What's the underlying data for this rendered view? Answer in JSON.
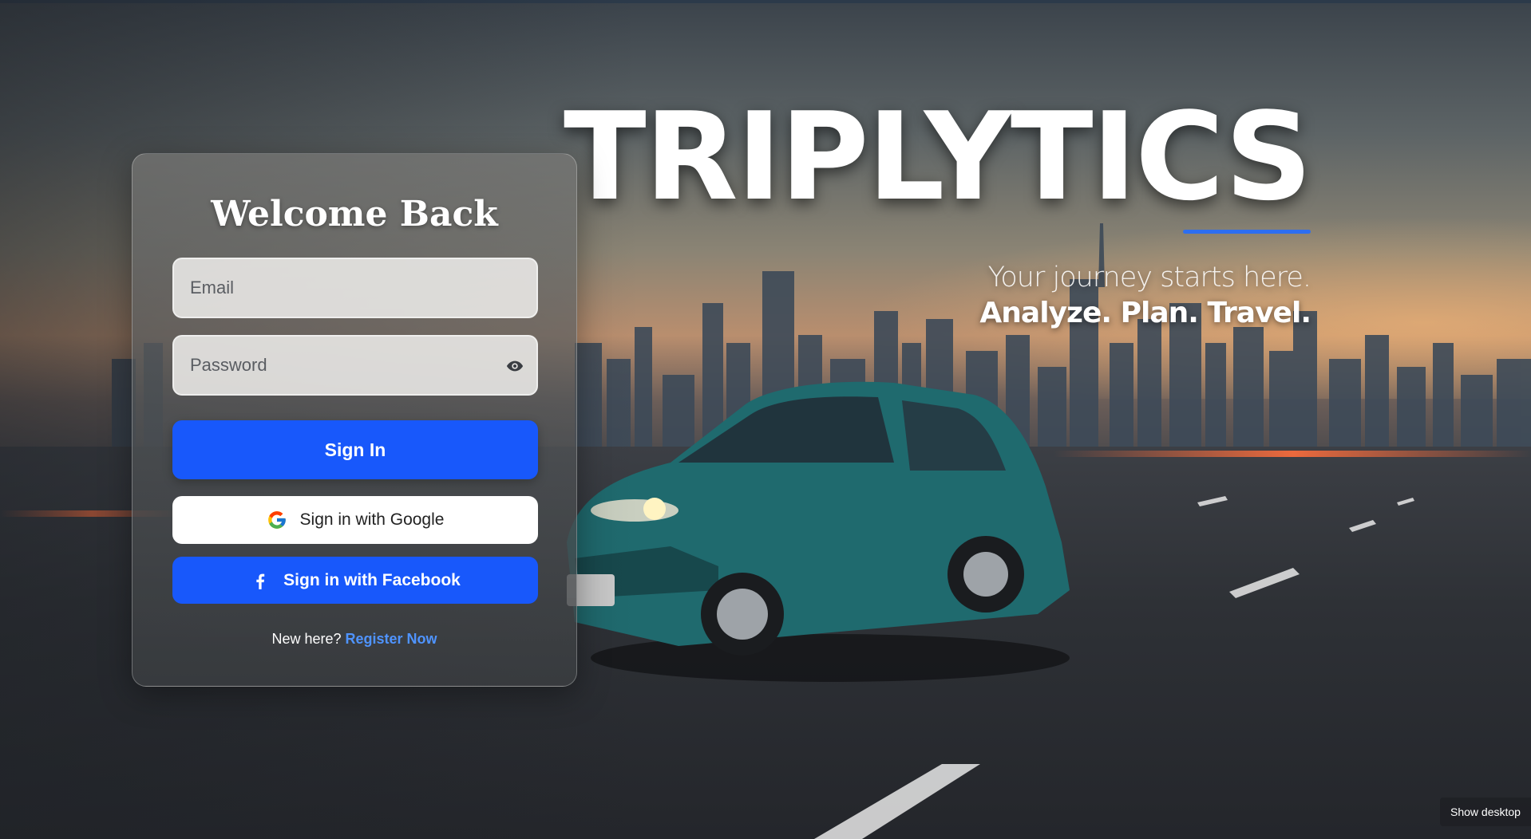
{
  "brand": {
    "title": "TRIPLYTICS",
    "tagline": "Your journey starts here.",
    "slogan": "Analyze. Plan. Travel.",
    "accent_color": "#2d6ef0"
  },
  "login": {
    "title": "Welcome Back",
    "email": {
      "placeholder": "Email",
      "value": ""
    },
    "password": {
      "placeholder": "Password",
      "value": "",
      "toggle_icon": "eye-icon"
    },
    "sign_in_label": "Sign In",
    "google_label": "Sign in with Google",
    "facebook_label": "Sign in with Facebook",
    "register_prompt": "New here?",
    "register_link": "Register Now",
    "primary_color": "#1858fb",
    "link_color": "#4f94ff"
  },
  "taskbar": {
    "show_desktop_label": "Show desktop"
  }
}
